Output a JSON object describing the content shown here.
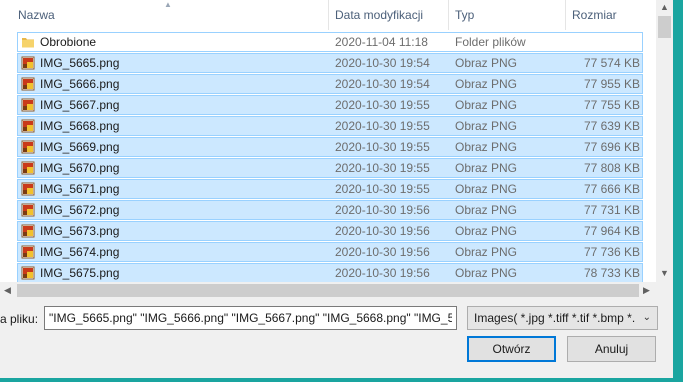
{
  "columns": {
    "name": "Nazwa",
    "date": "Data modyfikacji",
    "type": "Typ",
    "size": "Rozmiar"
  },
  "rows": [
    {
      "icon": "folder-icon",
      "name": "Obrobione",
      "date": "2020-11-04 11:18",
      "type": "Folder plików",
      "size": "",
      "selected": false
    },
    {
      "icon": "png-image-icon",
      "name": "IMG_5665.png",
      "date": "2020-10-30 19:54",
      "type": "Obraz PNG",
      "size": "77 574 KB",
      "selected": true
    },
    {
      "icon": "png-image-icon",
      "name": "IMG_5666.png",
      "date": "2020-10-30 19:54",
      "type": "Obraz PNG",
      "size": "77 955 KB",
      "selected": true
    },
    {
      "icon": "png-image-icon",
      "name": "IMG_5667.png",
      "date": "2020-10-30 19:55",
      "type": "Obraz PNG",
      "size": "77 755 KB",
      "selected": true
    },
    {
      "icon": "png-image-icon",
      "name": "IMG_5668.png",
      "date": "2020-10-30 19:55",
      "type": "Obraz PNG",
      "size": "77 639 KB",
      "selected": true
    },
    {
      "icon": "png-image-icon",
      "name": "IMG_5669.png",
      "date": "2020-10-30 19:55",
      "type": "Obraz PNG",
      "size": "77 696 KB",
      "selected": true
    },
    {
      "icon": "png-image-icon",
      "name": "IMG_5670.png",
      "date": "2020-10-30 19:55",
      "type": "Obraz PNG",
      "size": "77 808 KB",
      "selected": true
    },
    {
      "icon": "png-image-icon",
      "name": "IMG_5671.png",
      "date": "2020-10-30 19:55",
      "type": "Obraz PNG",
      "size": "77 666 KB",
      "selected": true
    },
    {
      "icon": "png-image-icon",
      "name": "IMG_5672.png",
      "date": "2020-10-30 19:56",
      "type": "Obraz PNG",
      "size": "77 731 KB",
      "selected": true
    },
    {
      "icon": "png-image-icon",
      "name": "IMG_5673.png",
      "date": "2020-10-30 19:56",
      "type": "Obraz PNG",
      "size": "77 964 KB",
      "selected": true
    },
    {
      "icon": "png-image-icon",
      "name": "IMG_5674.png",
      "date": "2020-10-30 19:56",
      "type": "Obraz PNG",
      "size": "77 736 KB",
      "selected": true
    },
    {
      "icon": "png-image-icon",
      "name": "IMG_5675.png",
      "date": "2020-10-30 19:56",
      "type": "Obraz PNG",
      "size": "78 733 KB",
      "selected": true
    }
  ],
  "footer": {
    "filename_label": "a pliku:",
    "filename_value": "\"IMG_5665.png\" \"IMG_5666.png\" \"IMG_5667.png\" \"IMG_5668.png\" \"IMG_5",
    "filter_value": "Images( *.jpg *.tiff *.tif *.bmp *.",
    "open_label": "Otwórz",
    "cancel_label": "Anuluj"
  },
  "colors": {
    "selection_bg": "#cce8ff",
    "selection_border": "#99d1ff",
    "header_text": "#4c607a",
    "frame_accent": "#1aa5a0"
  }
}
